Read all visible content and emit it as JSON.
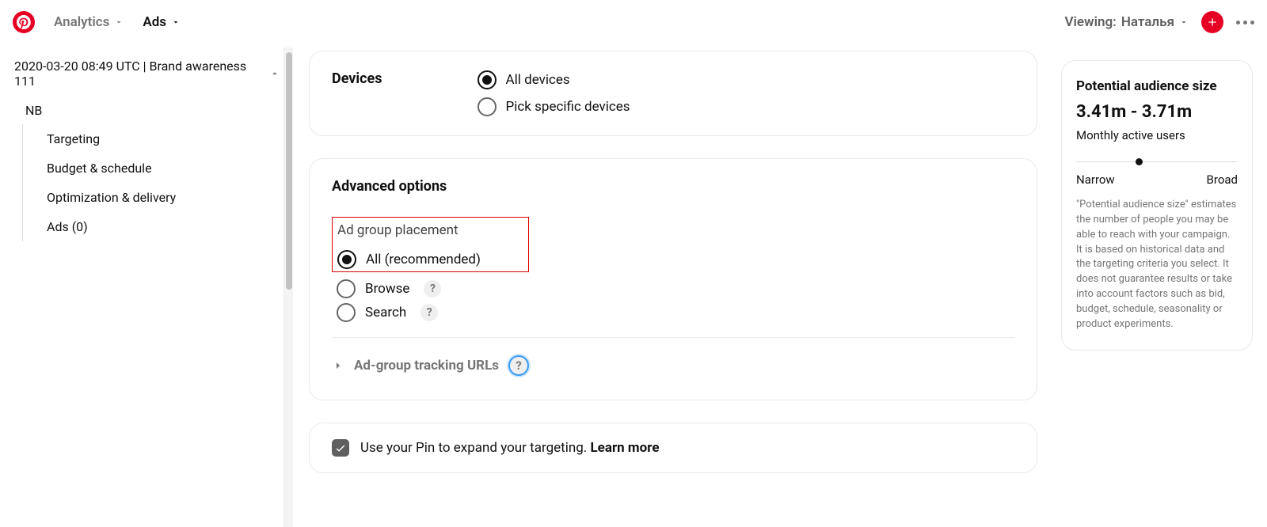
{
  "header": {
    "nav_analytics": "Analytics",
    "nav_ads": "Ads",
    "viewing_prefix": "Viewing:",
    "viewing_name": "Наталья"
  },
  "sidebar": {
    "campaign_title": "2020-03-20 08:49 UTC | Brand awareness 111",
    "adgroup_name": "NB",
    "items": [
      {
        "label": "Targeting"
      },
      {
        "label": "Budget & schedule"
      },
      {
        "label": "Optimization & delivery"
      },
      {
        "label": "Ads (0)"
      }
    ]
  },
  "devices": {
    "title": "Devices",
    "options": [
      {
        "label": "All devices",
        "selected": true
      },
      {
        "label": "Pick specific devices",
        "selected": false
      }
    ]
  },
  "advanced": {
    "title": "Advanced options",
    "placement_title": "Ad group placement",
    "placement_options": [
      {
        "label": "All (recommended)",
        "selected": true,
        "help": false
      },
      {
        "label": "Browse",
        "selected": false,
        "help": true
      },
      {
        "label": "Search",
        "selected": false,
        "help": true
      }
    ],
    "tracking_label": "Ad-group tracking URLs",
    "help_glyph": "?"
  },
  "expand_targeting": {
    "text": "Use your Pin to expand your targeting.",
    "learn_more": "Learn more"
  },
  "audience": {
    "title": "Potential audience size",
    "range": "3.41m - 3.71m",
    "subtitle": "Monthly active users",
    "slider_min_label": "Narrow",
    "slider_max_label": "Broad",
    "note": "\"Potential audience size\" estimates the number of people you may be able to reach with your campaign. It is based on historical data and the targeting criteria you select. It does not guarantee results or take into account factors such as bid, budget, schedule, seasonality or product experiments."
  }
}
